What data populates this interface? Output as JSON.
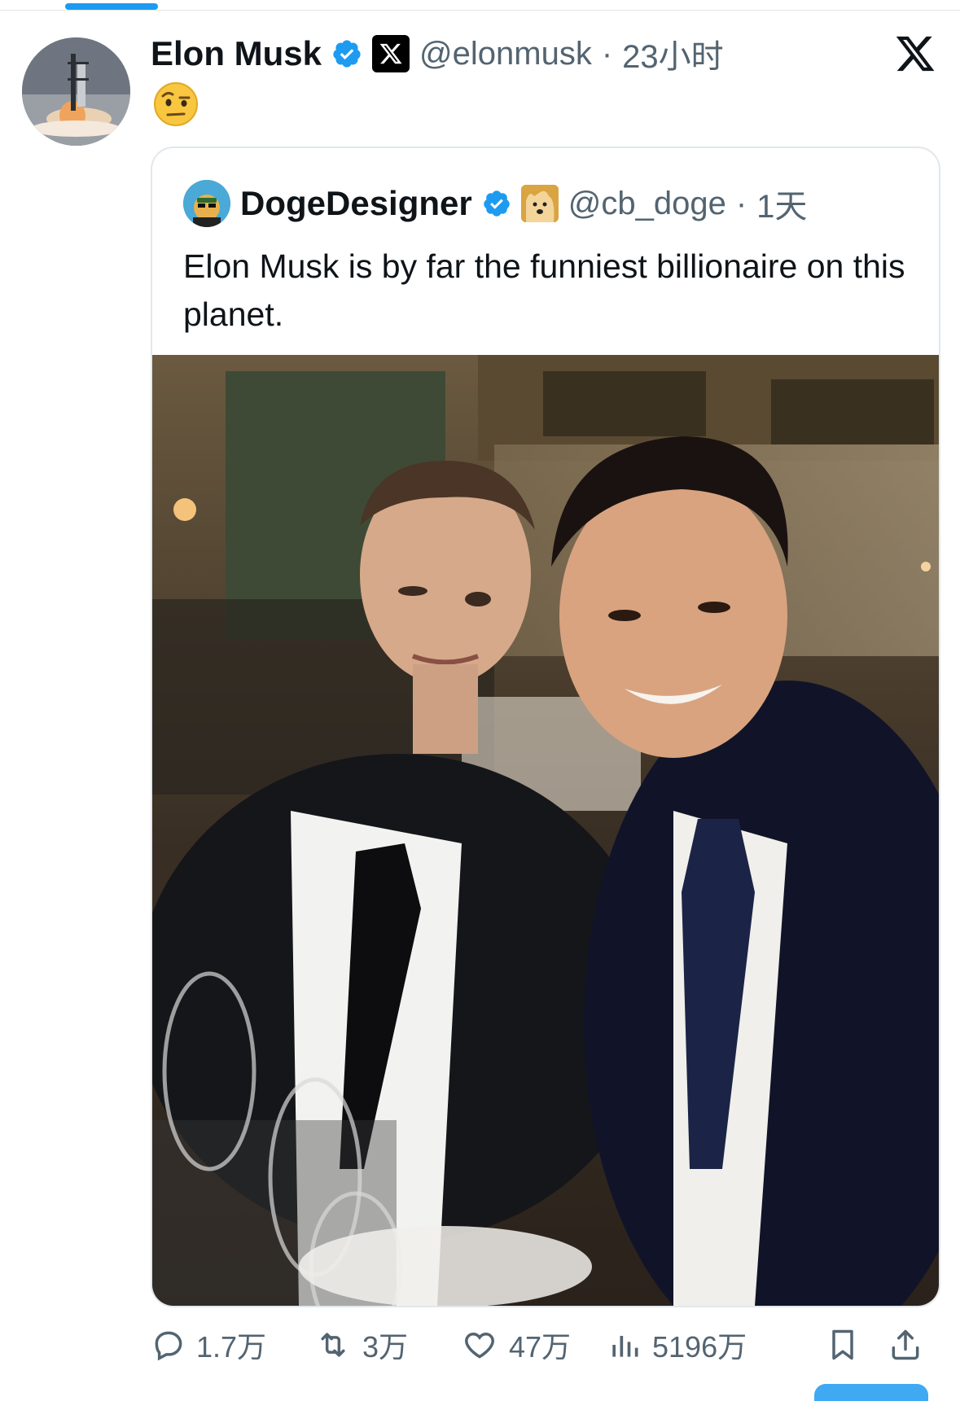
{
  "tweet": {
    "author_name": "Elon Musk",
    "handle": "@elonmusk",
    "separator": "·",
    "time": "23小时",
    "emoji": "🤨"
  },
  "quote": {
    "author_name": "DogeDesigner",
    "handle": "@cb_doge",
    "separator": "·",
    "time": "1天",
    "text": "Elon Musk is by far the funniest billionaire on this planet."
  },
  "actions": {
    "replies": "1.7万",
    "retweets": "3万",
    "likes": "47万",
    "views": "5196万"
  },
  "icons": {
    "verified": "verified-badge-icon",
    "x_logo": "x-logo-icon",
    "reply": "comment-icon",
    "retweet": "retweet-icon",
    "like": "heart-icon",
    "views": "bar-chart-icon",
    "bookmark": "bookmark-icon",
    "share": "share-icon"
  },
  "colors": {
    "accent": "#1d9bf0",
    "secondary_text": "#536471",
    "primary_text": "#0f1419"
  }
}
